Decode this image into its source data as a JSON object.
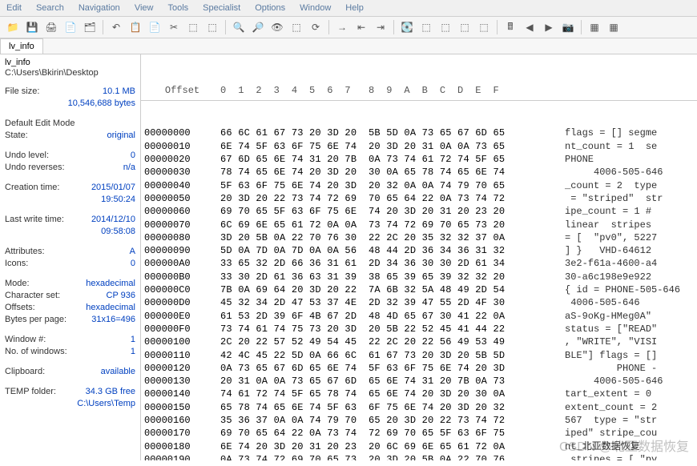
{
  "menu": [
    "Edit",
    "Search",
    "Navigation",
    "View",
    "Tools",
    "Specialist",
    "Options",
    "Window",
    "Help"
  ],
  "tab": "lv_info",
  "sidebar": {
    "title": "lv_info",
    "path": "C:\\Users\\Bkirin\\Desktop",
    "filesize_label": "File size:",
    "filesize_val": "10.1 MB",
    "filesize_bytes": "10,546,688 bytes",
    "editmode_label": "Default Edit Mode",
    "state_label": "State:",
    "state_val": "original",
    "undo_level_label": "Undo level:",
    "undo_level_val": "0",
    "undo_rev_label": "Undo reverses:",
    "undo_rev_val": "n/a",
    "ctime_label": "Creation time:",
    "ctime_val": "2015/01/07",
    "ctime_val2": "19:50:24",
    "wtime_label": "Last write time:",
    "wtime_val": "2014/12/10",
    "wtime_val2": "09:58:08",
    "attr_label": "Attributes:",
    "attr_val": "A",
    "icons_label": "Icons:",
    "icons_val": "0",
    "mode_label": "Mode:",
    "mode_val": "hexadecimal",
    "charset_label": "Character set:",
    "charset_val": "CP 936",
    "offsets_label": "Offsets:",
    "offsets_val": "hexadecimal",
    "bpp_label": "Bytes per page:",
    "bpp_val": "31x16=496",
    "win_label": "Window #:",
    "win_val": "1",
    "nwin_label": "No. of windows:",
    "nwin_val": "1",
    "clip_label": "Clipboard:",
    "clip_val": "available",
    "temp_label": "TEMP folder:",
    "temp_val": "34.3 GB free",
    "temp_path": "C:\\Users\\Temp"
  },
  "hex": {
    "header_offset": "Offset",
    "header_cols": "0  1  2  3  4  5  6  7   8  9  A  B  C  D  E  F",
    "rows": [
      {
        "o": "00000000",
        "b": "66 6C 61 67 73 20 3D 20  5B 5D 0A 73 65 67 6D 65",
        "a": "flags = [] segme"
      },
      {
        "o": "00000010",
        "b": "6E 74 5F 63 6F 75 6E 74  20 3D 20 31 0A 0A 73 65",
        "a": "nt_count = 1  se"
      },
      {
        "o": "00000020",
        "b": "67 6D 65 6E 74 31 20 7B  0A 73 74 61 72 74 5F 65",
        "a": "PHONE"
      },
      {
        "o": "00000030",
        "b": "78 74 65 6E 74 20 3D 20  30 0A 65 78 74 65 6E 74",
        "a": "     4006-505-646"
      },
      {
        "o": "00000040",
        "b": "5F 63 6F 75 6E 74 20 3D  20 32 0A 0A 74 79 70 65",
        "a": "_count = 2  type"
      },
      {
        "o": "00000050",
        "b": "20 3D 20 22 73 74 72 69  70 65 64 22 0A 73 74 72",
        "a": " = \"striped\"  str"
      },
      {
        "o": "00000060",
        "b": "69 70 65 5F 63 6F 75 6E  74 20 3D 20 31 20 23 20",
        "a": "ipe_count = 1 #"
      },
      {
        "o": "00000070",
        "b": "6C 69 6E 65 61 72 0A 0A  73 74 72 69 70 65 73 20",
        "a": "linear  stripes"
      },
      {
        "o": "00000080",
        "b": "3D 20 5B 0A 22 70 76 30  22 2C 20 35 32 32 37 0A",
        "a": "= [  \"pv0\", 5227"
      },
      {
        "o": "00000090",
        "b": "5D 0A 7D 0A 7D 0A 0A 56  48 44 2D 36 34 36 31 32",
        "a": "] }   VHD-64612"
      },
      {
        "o": "000000A0",
        "b": "33 65 32 2D 66 36 31 61  2D 34 36 30 30 2D 61 34",
        "a": "3e2-f61a-4600-a4"
      },
      {
        "o": "000000B0",
        "b": "33 30 2D 61 36 63 31 39  38 65 39 65 39 32 32 20",
        "a": "30-a6c198e9e922"
      },
      {
        "o": "000000C0",
        "b": "7B 0A 69 64 20 3D 20 22  7A 6B 32 5A 48 49 2D 54",
        "a": "{ id = PHONE-505-646"
      },
      {
        "o": "000000D0",
        "b": "45 32 34 2D 47 53 37 4E  2D 32 39 47 55 2D 4F 30",
        "a": " 4006-505-646"
      },
      {
        "o": "000000E0",
        "b": "61 53 2D 39 6F 4B 67 2D  48 4D 65 67 30 41 22 0A",
        "a": "aS-9oKg-HMeg0A\""
      },
      {
        "o": "000000F0",
        "b": "73 74 61 74 75 73 20 3D  20 5B 22 52 45 41 44 22",
        "a": "status = [\"READ\""
      },
      {
        "o": "00000100",
        "b": "2C 20 22 57 52 49 54 45  22 2C 20 22 56 49 53 49",
        "a": ", \"WRITE\", \"VISI"
      },
      {
        "o": "00000110",
        "b": "42 4C 45 22 5D 0A 66 6C  61 67 73 20 3D 20 5B 5D",
        "a": "BLE\"] flags = []"
      },
      {
        "o": "00000120",
        "b": "0A 73 65 67 6D 65 6E 74  5F 63 6F 75 6E 74 20 3D",
        "a": "         PHONE -"
      },
      {
        "o": "00000130",
        "b": "20 31 0A 0A 73 65 67 6D  65 6E 74 31 20 7B 0A 73",
        "a": "     4006-505-646"
      },
      {
        "o": "00000140",
        "b": "74 61 72 74 5F 65 78 74  65 6E 74 20 3D 20 30 0A",
        "a": "tart_extent = 0"
      },
      {
        "o": "00000150",
        "b": "65 78 74 65 6E 74 5F 63  6F 75 6E 74 20 3D 20 32",
        "a": "extent_count = 2"
      },
      {
        "o": "00000160",
        "b": "35 36 37 0A 0A 74 79 70  65 20 3D 20 22 73 74 72",
        "a": "567  type = \"str"
      },
      {
        "o": "00000170",
        "b": "69 70 65 64 22 0A 73 74  72 69 70 65 5F 63 6F 75",
        "a": "iped\" stripe_cou"
      },
      {
        "o": "00000180",
        "b": "6E 74 20 3D 20 31 20 23  20 6C 69 6E 65 61 72 0A",
        "a": "nt_北亚数据恢复"
      },
      {
        "o": "00000190",
        "b": "0A 73 74 72 69 70 65 73  20 3D 20 5B 0A 22 70 76",
        "a": " stripes = [ \"pv"
      }
    ]
  },
  "watermark": "CSDN @北亚数据恢复"
}
